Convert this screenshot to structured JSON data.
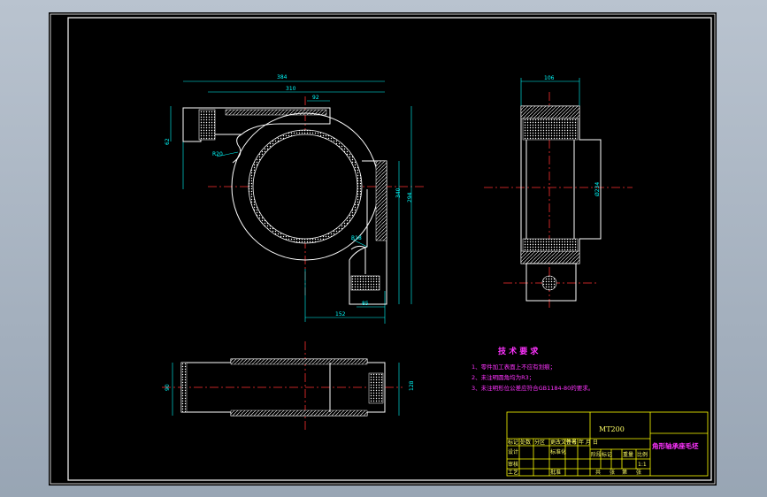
{
  "drawing": {
    "colors": {
      "background": "#000000",
      "frame": "#ffffff",
      "dimension": "#00ffff",
      "centerline": "#ff3030",
      "requirements": "#ff33ff",
      "titleblock": "#ffff00"
    },
    "dimensions": {
      "top_width": "384",
      "top_inner": "310",
      "top_small": "92",
      "left_height": "62",
      "radius_left": "R20",
      "right_height_a": "340",
      "right_height_b": "294",
      "radius_right": "R18",
      "bottom_width": "152",
      "bottom_small": "85",
      "side_width": "106",
      "side_dia": "Ø234",
      "plan_left": "90",
      "plan_right": "128"
    },
    "requirements": {
      "title": "技 术 要 求",
      "items": [
        "1、零件加工表面上不应有划痕；",
        "2、未注明圆角均为R3；",
        "3、未注明形位公差应符合GB1184-80的要求。"
      ]
    },
    "titleblock": {
      "model": "MT200",
      "part_name": "角形轴承座毛坯",
      "labels": {
        "mark": "标记",
        "count": "处数",
        "zone": "分区",
        "change_doc": "更改文件号",
        "sign": "签名",
        "date": "年 月 日",
        "design": "设计",
        "standard": "标准化",
        "stage": "阶段标记",
        "weight": "重量",
        "scale": "比例",
        "ratio": "1:1",
        "review": "审核",
        "craft": "工艺",
        "approve": "批准",
        "sheet_total": "共",
        "sheet": "张",
        "sheet_no": "第",
        "sheet2": "张"
      }
    }
  }
}
